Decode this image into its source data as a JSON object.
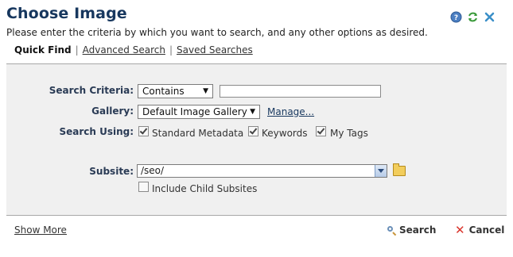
{
  "dialog": {
    "title": "Choose Image",
    "subtitle": "Please enter the criteria by which you want to search, and any other options as desired.",
    "header_icons": [
      "help-icon",
      "refresh-icon",
      "close-icon"
    ]
  },
  "tabs": {
    "active": "Quick Find",
    "advanced": "Advanced Search",
    "saved": "Saved Searches"
  },
  "form": {
    "criteria_label": "Search Criteria:",
    "criteria_mode": "Contains",
    "criteria_value": "",
    "gallery_label": "Gallery:",
    "gallery_value": "Default Image Gallery",
    "manage_link": "Manage...",
    "search_using_label": "Search Using:",
    "options": [
      {
        "label": "Standard Metadata",
        "checked": true
      },
      {
        "label": "Keywords",
        "checked": true
      },
      {
        "label": "My Tags",
        "checked": true
      }
    ],
    "subsite_label": "Subsite:",
    "subsite_value": "/seo/",
    "include_child_label": "Include Child Subsites",
    "include_child_checked": false
  },
  "footer": {
    "show_more": "Show More",
    "search_label": "Search",
    "cancel_label": "Cancel"
  },
  "colors": {
    "title": "#17375e",
    "panel_bg": "#f0f0f0",
    "cancel_icon": "#d9342b"
  }
}
